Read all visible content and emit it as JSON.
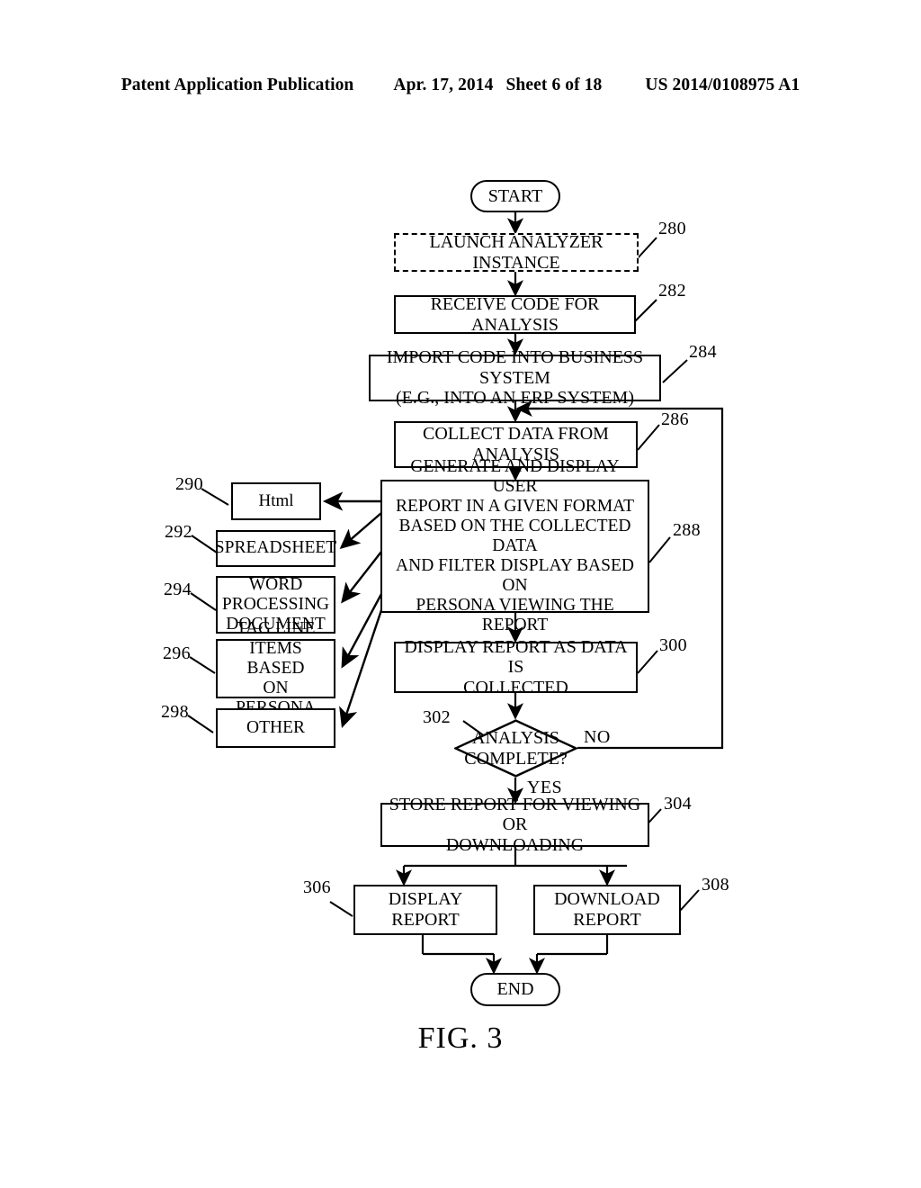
{
  "header": {
    "left": "Patent Application Publication",
    "date": "Apr. 17, 2014",
    "sheet": "Sheet 6 of 18",
    "patent_number": "US 2014/0108975 A1"
  },
  "figure": {
    "caption": "FIG. 3"
  },
  "flow": {
    "start": {
      "label": "START",
      "ref": ""
    },
    "launch": {
      "label": "LAUNCH ANALYZER INSTANCE",
      "ref": "280"
    },
    "receive": {
      "label": "RECEIVE CODE FOR ANALYSIS",
      "ref": "282"
    },
    "import": {
      "label": "IMPORT CODE INTO BUSINESS SYSTEM\n(E.G., INTO AN ERP SYSTEM)",
      "ref": "284"
    },
    "collect": {
      "label": "COLLECT DATA FROM\nANALYSIS",
      "ref": "286"
    },
    "generate": {
      "label": "GENERATE AND DISPLAY USER\nREPORT IN A GIVEN FORMAT\nBASED ON THE COLLECTED DATA\nAND FILTER DISPLAY BASED ON\nPERSONA VIEWING THE REPORT",
      "ref": "288"
    },
    "display_as_collected": {
      "label": "DISPLAY REPORT AS DATA IS\nCOLLECTED",
      "ref": "300"
    },
    "decision": {
      "label": "ANALYSIS\nCOMPLETE?",
      "ref": "302",
      "yes": "YES",
      "no": "NO"
    },
    "store": {
      "label": "STORE REPORT FOR VIEWING OR\nDOWNLOADING",
      "ref": "304"
    },
    "display_report": {
      "label": "DISPLAY REPORT",
      "ref": "306"
    },
    "download_report": {
      "label": "DOWNLOAD\nREPORT",
      "ref": "308"
    },
    "end": {
      "label": "END",
      "ref": ""
    }
  },
  "formats": [
    {
      "label": "Html",
      "ref": "290"
    },
    {
      "label": "SPREADSHEET",
      "ref": "292"
    },
    {
      "label": "WORD\nPROCESSING\nDOCUMENT",
      "ref": "294"
    },
    {
      "label": "TAG LINE\nITEMS BASED\nON PERSONA",
      "ref": "296"
    },
    {
      "label": "OTHER",
      "ref": "298"
    }
  ],
  "colors": {
    "ink": "#000000",
    "paper": "#ffffff"
  }
}
